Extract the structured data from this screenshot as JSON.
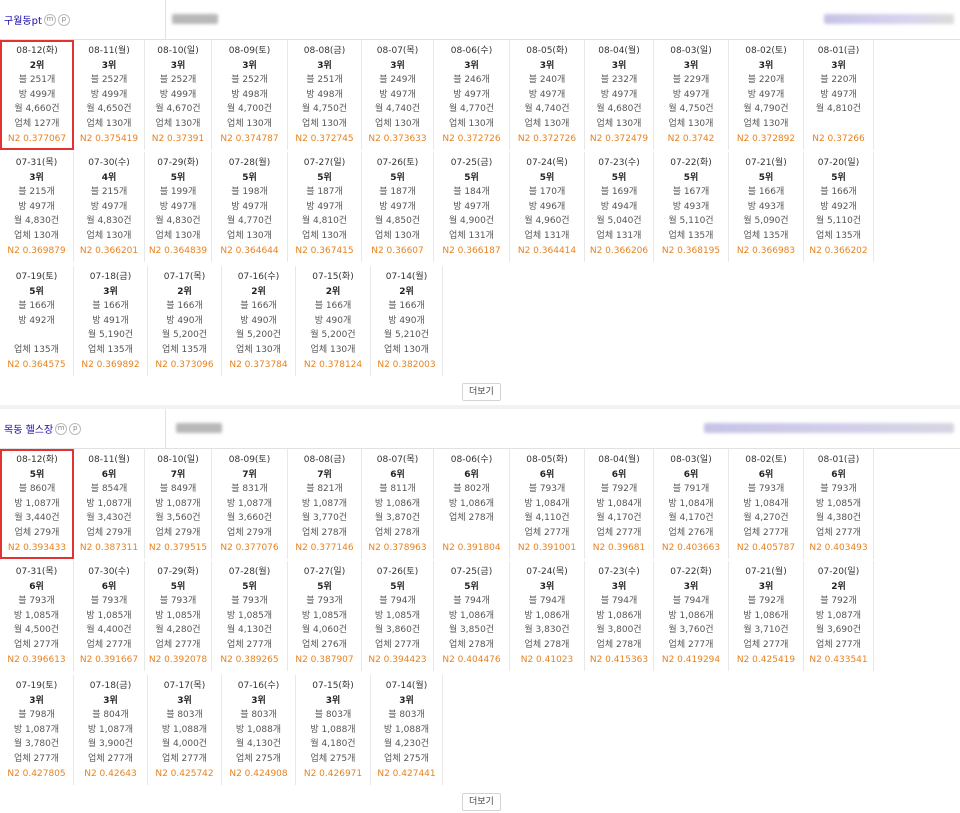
{
  "sections": [
    {
      "name": "구월동pt",
      "badges": [
        "m",
        "p"
      ],
      "more_label": "더보기",
      "rows": [
        [
          {
            "date": "08-12(화)",
            "rank": "2위",
            "blog": "블 251개",
            "room": "방 499개",
            "month": "월 4,660건",
            "biz": "업체 127개",
            "n2": "N2 0.377067",
            "hl": true
          },
          {
            "date": "08-11(월)",
            "rank": "3위",
            "blog": "블 252개",
            "room": "방 499개",
            "month": "월 4,650건",
            "biz": "업체 130개",
            "n2": "N2 0.375419"
          },
          {
            "date": "08-10(일)",
            "rank": "3위",
            "blog": "블 252개",
            "room": "방 499개",
            "month": "월 4,670건",
            "biz": "업체 130개",
            "n2": "N2 0.37391"
          },
          {
            "date": "08-09(토)",
            "rank": "3위",
            "blog": "블 252개",
            "room": "방 498개",
            "month": "월 4,700건",
            "biz": "업체 130개",
            "n2": "N2 0.374787"
          },
          {
            "date": "08-08(금)",
            "rank": "3위",
            "blog": "블 251개",
            "room": "방 498개",
            "month": "월 4,750건",
            "biz": "업체 130개",
            "n2": "N2 0.372745"
          },
          {
            "date": "08-07(목)",
            "rank": "3위",
            "blog": "블 249개",
            "room": "방 497개",
            "month": "월 4,740건",
            "biz": "업체 130개",
            "n2": "N2 0.373633"
          },
          {
            "date": "08-06(수)",
            "rank": "3위",
            "blog": "블 246개",
            "room": "방 497개",
            "month": "월 4,770건",
            "biz": "업체 130개",
            "n2": "N2 0.372726"
          },
          {
            "date": "08-05(화)",
            "rank": "3위",
            "blog": "블 240개",
            "room": "방 497개",
            "month": "월 4,740건",
            "biz": "업체 130개",
            "n2": "N2 0.372726"
          },
          {
            "date": "08-04(월)",
            "rank": "3위",
            "blog": "블 232개",
            "room": "방 497개",
            "month": "월 4,680건",
            "biz": "업체 130개",
            "n2": "N2 0.372479"
          },
          {
            "date": "08-03(일)",
            "rank": "3위",
            "blog": "블 229개",
            "room": "방 497개",
            "month": "월 4,750건",
            "biz": "업체 130개",
            "n2": "N2 0.3742"
          },
          {
            "date": "08-02(토)",
            "rank": "3위",
            "blog": "블 220개",
            "room": "방 497개",
            "month": "월 4,790건",
            "biz": "업체 130개",
            "n2": "N2 0.372892"
          },
          {
            "date": "08-01(금)",
            "rank": "3위",
            "blog": "블 220개",
            "room": "방 497개",
            "month": "월 4,810건",
            "biz": "",
            "n2": "N2 0.37266"
          }
        ],
        [
          {
            "date": "07-31(목)",
            "rank": "3위",
            "blog": "블 215개",
            "room": "방 497개",
            "month": "월 4,830건",
            "biz": "업체 130개",
            "n2": "N2 0.369879"
          },
          {
            "date": "07-30(수)",
            "rank": "4위",
            "blog": "블 215개",
            "room": "방 497개",
            "month": "월 4,830건",
            "biz": "업체 130개",
            "n2": "N2 0.366201"
          },
          {
            "date": "07-29(화)",
            "rank": "5위",
            "blog": "블 199개",
            "room": "방 497개",
            "month": "월 4,830건",
            "biz": "업체 130개",
            "n2": "N2 0.364839"
          },
          {
            "date": "07-28(월)",
            "rank": "5위",
            "blog": "블 198개",
            "room": "방 497개",
            "month": "월 4,770건",
            "biz": "업체 130개",
            "n2": "N2 0.364644"
          },
          {
            "date": "07-27(일)",
            "rank": "5위",
            "blog": "블 187개",
            "room": "방 497개",
            "month": "월 4,810건",
            "biz": "업체 130개",
            "n2": "N2 0.367415"
          },
          {
            "date": "07-26(토)",
            "rank": "5위",
            "blog": "블 187개",
            "room": "방 497개",
            "month": "월 4,850건",
            "biz": "업체 130개",
            "n2": "N2 0.36607"
          },
          {
            "date": "07-25(금)",
            "rank": "5위",
            "blog": "블 184개",
            "room": "방 497개",
            "month": "월 4,900건",
            "biz": "업체 131개",
            "n2": "N2 0.366187"
          },
          {
            "date": "07-24(목)",
            "rank": "5위",
            "blog": "블 170개",
            "room": "방 496개",
            "month": "월 4,960건",
            "biz": "업체 131개",
            "n2": "N2 0.364414"
          },
          {
            "date": "07-23(수)",
            "rank": "5위",
            "blog": "블 169개",
            "room": "방 494개",
            "month": "월 5,040건",
            "biz": "업체 131개",
            "n2": "N2 0.366206"
          },
          {
            "date": "07-22(화)",
            "rank": "5위",
            "blog": "블 167개",
            "room": "방 493개",
            "month": "월 5,110건",
            "biz": "업체 135개",
            "n2": "N2 0.368195"
          },
          {
            "date": "07-21(월)",
            "rank": "5위",
            "blog": "블 166개",
            "room": "방 493개",
            "month": "월 5,090건",
            "biz": "업체 135개",
            "n2": "N2 0.366983"
          },
          {
            "date": "07-20(일)",
            "rank": "5위",
            "blog": "블 166개",
            "room": "방 492개",
            "month": "월 5,110건",
            "biz": "업체 135개",
            "n2": "N2 0.366202"
          }
        ],
        [
          {
            "date": "07-19(토)",
            "rank": "5위",
            "blog": "블 166개",
            "room": "방 492개",
            "month": "",
            "biz": "업체 135개",
            "n2": "N2 0.364575"
          },
          {
            "date": "07-18(금)",
            "rank": "3위",
            "blog": "블 166개",
            "room": "방 491개",
            "month": "월 5,190건",
            "biz": "업체 135개",
            "n2": "N2 0.369892"
          },
          {
            "date": "07-17(목)",
            "rank": "2위",
            "blog": "블 166개",
            "room": "방 490개",
            "month": "월 5,200건",
            "biz": "업체 135개",
            "n2": "N2 0.373096"
          },
          {
            "date": "07-16(수)",
            "rank": "2위",
            "blog": "블 166개",
            "room": "방 490개",
            "month": "월 5,200건",
            "biz": "업체 130개",
            "n2": "N2 0.373784"
          },
          {
            "date": "07-15(화)",
            "rank": "2위",
            "blog": "블 166개",
            "room": "방 490개",
            "month": "월 5,200건",
            "biz": "업체 130개",
            "n2": "N2 0.378124"
          },
          {
            "date": "07-14(월)",
            "rank": "2위",
            "blog": "블 166개",
            "room": "방 490개",
            "month": "월 5,210건",
            "biz": "업체 130개",
            "n2": "N2 0.382003"
          }
        ]
      ]
    },
    {
      "name": "목동 헬스장",
      "badges": [
        "m",
        "p"
      ],
      "more_label": "더보기",
      "rows": [
        [
          {
            "date": "08-12(화)",
            "rank": "5위",
            "blog": "블 860개",
            "room": "방 1,087개",
            "month": "월 3,440건",
            "biz": "업체 279개",
            "n2": "N2 0.393433",
            "hl": true
          },
          {
            "date": "08-11(월)",
            "rank": "6위",
            "blog": "블 854개",
            "room": "방 1,087개",
            "month": "월 3,430건",
            "biz": "업체 279개",
            "n2": "N2 0.387311"
          },
          {
            "date": "08-10(일)",
            "rank": "7위",
            "blog": "블 849개",
            "room": "방 1,087개",
            "month": "월 3,560건",
            "biz": "업체 279개",
            "n2": "N2 0.379515"
          },
          {
            "date": "08-09(토)",
            "rank": "7위",
            "blog": "블 831개",
            "room": "방 1,087개",
            "month": "월 3,660건",
            "biz": "업체 279개",
            "n2": "N2 0.377076"
          },
          {
            "date": "08-08(금)",
            "rank": "7위",
            "blog": "블 821개",
            "room": "방 1,087개",
            "month": "월 3,770건",
            "biz": "업체 278개",
            "n2": "N2 0.377146"
          },
          {
            "date": "08-07(목)",
            "rank": "6위",
            "blog": "블 811개",
            "room": "방 1,086개",
            "month": "월 3,870건",
            "biz": "업체 278개",
            "n2": "N2 0.378963"
          },
          {
            "date": "08-06(수)",
            "rank": "6위",
            "blog": "블 802개",
            "room": "방 1,086개",
            "month": "업체 278개",
            "biz": "",
            "n2": "N2 0.391804"
          },
          {
            "date": "08-05(화)",
            "rank": "6위",
            "blog": "블 793개",
            "room": "방 1,084개",
            "month": "월 4,110건",
            "biz": "업체 277개",
            "n2": "N2 0.391001"
          },
          {
            "date": "08-04(월)",
            "rank": "6위",
            "blog": "블 792개",
            "room": "방 1,084개",
            "month": "월 4,170건",
            "biz": "업체 277개",
            "n2": "N2 0.39681"
          },
          {
            "date": "08-03(일)",
            "rank": "6위",
            "blog": "블 791개",
            "room": "방 1,084개",
            "month": "월 4,170건",
            "biz": "업체 276개",
            "n2": "N2 0.403663"
          },
          {
            "date": "08-02(토)",
            "rank": "6위",
            "blog": "블 793개",
            "room": "방 1,084개",
            "month": "월 4,270건",
            "biz": "업체 277개",
            "n2": "N2 0.405787"
          },
          {
            "date": "08-01(금)",
            "rank": "6위",
            "blog": "블 793개",
            "room": "방 1,085개",
            "month": "월 4,380건",
            "biz": "업체 277개",
            "n2": "N2 0.403493"
          }
        ],
        [
          {
            "date": "07-31(목)",
            "rank": "6위",
            "blog": "블 793개",
            "room": "방 1,085개",
            "month": "월 4,500건",
            "biz": "업체 277개",
            "n2": "N2 0.396613"
          },
          {
            "date": "07-30(수)",
            "rank": "6위",
            "blog": "블 793개",
            "room": "방 1,085개",
            "month": "월 4,400건",
            "biz": "업체 277개",
            "n2": "N2 0.391667"
          },
          {
            "date": "07-29(화)",
            "rank": "5위",
            "blog": "블 793개",
            "room": "방 1,085개",
            "month": "월 4,280건",
            "biz": "업체 277개",
            "n2": "N2 0.392078"
          },
          {
            "date": "07-28(월)",
            "rank": "5위",
            "blog": "블 793개",
            "room": "방 1,085개",
            "month": "월 4,130건",
            "biz": "업체 277개",
            "n2": "N2 0.389265"
          },
          {
            "date": "07-27(일)",
            "rank": "5위",
            "blog": "블 793개",
            "room": "방 1,085개",
            "month": "월 4,060건",
            "biz": "업체 276개",
            "n2": "N2 0.387907"
          },
          {
            "date": "07-26(토)",
            "rank": "5위",
            "blog": "블 794개",
            "room": "방 1,085개",
            "month": "월 3,860건",
            "biz": "업체 277개",
            "n2": "N2 0.394423"
          },
          {
            "date": "07-25(금)",
            "rank": "5위",
            "blog": "블 794개",
            "room": "방 1,086개",
            "month": "월 3,850건",
            "biz": "업체 278개",
            "n2": "N2 0.404476"
          },
          {
            "date": "07-24(목)",
            "rank": "3위",
            "blog": "블 794개",
            "room": "방 1,086개",
            "month": "월 3,830건",
            "biz": "업체 278개",
            "n2": "N2 0.41023"
          },
          {
            "date": "07-23(수)",
            "rank": "3위",
            "blog": "블 794개",
            "room": "방 1,086개",
            "month": "월 3,800건",
            "biz": "업체 278개",
            "n2": "N2 0.415363"
          },
          {
            "date": "07-22(화)",
            "rank": "3위",
            "blog": "블 794개",
            "room": "방 1,086개",
            "month": "월 3,760건",
            "biz": "업체 277개",
            "n2": "N2 0.419294"
          },
          {
            "date": "07-21(월)",
            "rank": "3위",
            "blog": "블 792개",
            "room": "방 1,086개",
            "month": "월 3,710건",
            "biz": "업체 277개",
            "n2": "N2 0.425419"
          },
          {
            "date": "07-20(일)",
            "rank": "2위",
            "blog": "블 792개",
            "room": "방 1,087개",
            "month": "월 3,690건",
            "biz": "업체 277개",
            "n2": "N2 0.433541"
          }
        ],
        [
          {
            "date": "07-19(토)",
            "rank": "3위",
            "blog": "블 798개",
            "room": "방 1,087개",
            "month": "월 3,780건",
            "biz": "업체 277개",
            "n2": "N2 0.427805"
          },
          {
            "date": "07-18(금)",
            "rank": "3위",
            "blog": "블 804개",
            "room": "방 1,087개",
            "month": "월 3,900건",
            "biz": "업체 277개",
            "n2": "N2 0.42643"
          },
          {
            "date": "07-17(목)",
            "rank": "3위",
            "blog": "블 803개",
            "room": "방 1,088개",
            "month": "월 4,000건",
            "biz": "업체 277개",
            "n2": "N2 0.425742"
          },
          {
            "date": "07-16(수)",
            "rank": "3위",
            "blog": "블 803개",
            "room": "방 1,088개",
            "month": "월 4,130건",
            "biz": "업체 275개",
            "n2": "N2 0.424908"
          },
          {
            "date": "07-15(화)",
            "rank": "3위",
            "blog": "블 803개",
            "room": "방 1,088개",
            "month": "월 4,180건",
            "biz": "업체 275개",
            "n2": "N2 0.426971"
          },
          {
            "date": "07-14(월)",
            "rank": "3위",
            "blog": "블 803개",
            "room": "방 1,088개",
            "month": "월 4,230건",
            "biz": "업체 275개",
            "n2": "N2 0.427441"
          }
        ]
      ]
    }
  ],
  "colors": {
    "link": "#1a0dab",
    "n2": "#e8821e",
    "highlight": "#e23232",
    "border": "#e8e8e8",
    "gap": "#f2f2f2"
  }
}
